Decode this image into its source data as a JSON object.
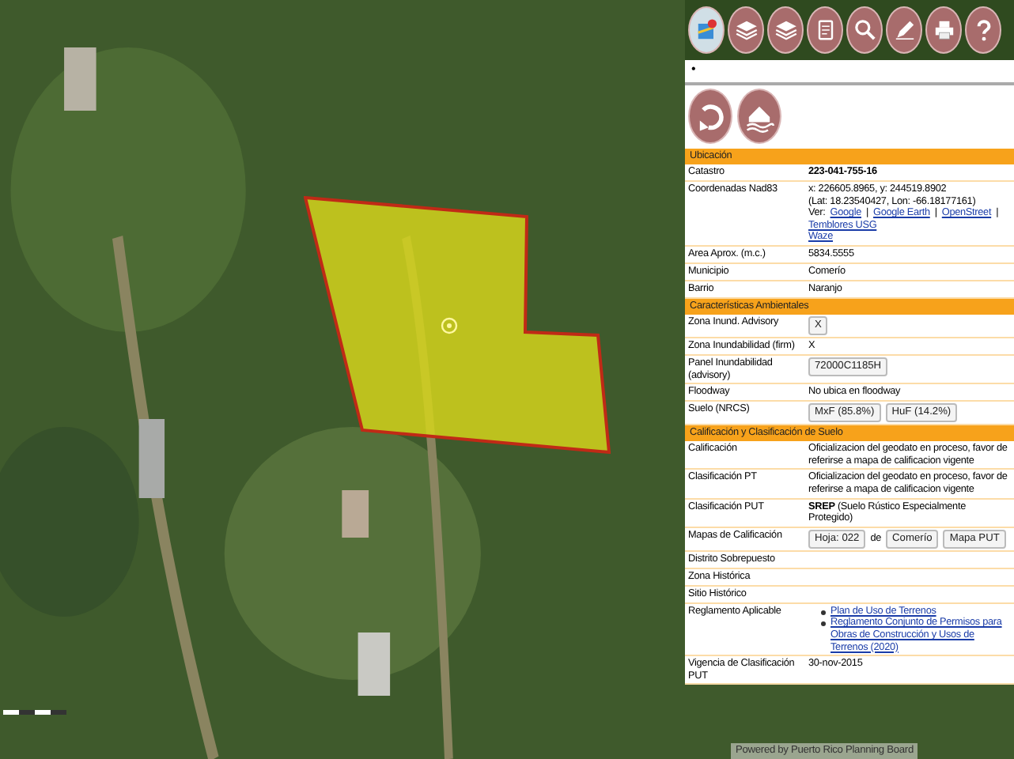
{
  "panel": {
    "marker": "•",
    "sections": [
      {
        "title": "Ubicación",
        "rows": [
          {
            "label": "Catastro",
            "lines": [
              [
                {
                  "kind": "bold",
                  "text": "223-041-755-16"
                }
              ]
            ]
          },
          {
            "label": "Coordenadas Nad83",
            "lines": [
              [
                {
                  "kind": "text",
                  "text": "x: 226605.8965, y: 244519.8902"
                }
              ],
              [
                {
                  "kind": "text",
                  "text": "(Lat: 18.23540427, Lon: -66.18177161)"
                }
              ],
              [
                {
                  "kind": "text",
                  "text": "Ver:"
                },
                {
                  "kind": "link",
                  "text": "Google"
                },
                {
                  "kind": "text",
                  "text": "|"
                },
                {
                  "kind": "link",
                  "text": "Google Earth"
                },
                {
                  "kind": "text",
                  "text": "|"
                },
                {
                  "kind": "link",
                  "text": "OpenStreet"
                },
                {
                  "kind": "text",
                  "text": "|"
                },
                {
                  "kind": "link",
                  "text": "Temblores USG"
                }
              ],
              [
                {
                  "kind": "link",
                  "text": "Waze"
                }
              ]
            ]
          },
          {
            "label": "Area Aprox. (m.c.)",
            "lines": [
              [
                {
                  "kind": "text",
                  "text": "5834.5555"
                }
              ]
            ]
          },
          {
            "label": "Municipio",
            "lines": [
              [
                {
                  "kind": "text",
                  "text": "Comerío"
                }
              ]
            ]
          },
          {
            "label": "Barrio",
            "lines": [
              [
                {
                  "kind": "text",
                  "text": "Naranjo"
                }
              ]
            ]
          }
        ]
      },
      {
        "title": "Características Ambientales",
        "rows": [
          {
            "label": "Zona Inund. Advisory",
            "lines": [
              [
                {
                  "kind": "button",
                  "text": "X"
                }
              ]
            ]
          },
          {
            "label": "Zona Inundabilidad (firm)",
            "lines": [
              [
                {
                  "kind": "text",
                  "text": "X"
                }
              ]
            ]
          },
          {
            "label": "Panel Inundabilidad (advisory)",
            "lines": [
              [
                {
                  "kind": "button",
                  "text": "72000C1185H"
                }
              ]
            ]
          },
          {
            "label": "Floodway",
            "lines": [
              [
                {
                  "kind": "text",
                  "text": "No ubica en floodway"
                }
              ]
            ]
          },
          {
            "label": "Suelo (NRCS)",
            "lines": [
              [
                {
                  "kind": "button",
                  "text": "MxF (85.8%)"
                },
                {
                  "kind": "button",
                  "text": "HuF (14.2%)"
                }
              ]
            ]
          }
        ]
      },
      {
        "title": "Calificación y Clasificación de Suelo",
        "rows": [
          {
            "label": "Calificación",
            "lines": [
              [
                {
                  "kind": "text",
                  "text": "Oficializacion del geodato en proceso, favor de referirse a mapa de calificacion vigente"
                }
              ]
            ]
          },
          {
            "label": "Clasificación PT",
            "lines": [
              [
                {
                  "kind": "text",
                  "text": "Oficializacion del geodato en proceso, favor de referirse a mapa de calificacion vigente"
                }
              ]
            ]
          },
          {
            "label": "Clasificación PUT",
            "lines": [
              [
                {
                  "kind": "rich",
                  "text": "**SREP** (Suelo Rústico Especialmente Protegido)"
                }
              ]
            ]
          },
          {
            "label": "Mapas de Calificación",
            "lines": [
              [
                {
                  "kind": "button",
                  "text": "Hoja: 022"
                },
                {
                  "kind": "text",
                  "text": "de"
                },
                {
                  "kind": "button",
                  "text": "Comerío"
                },
                {
                  "kind": "button",
                  "text": "Mapa PUT"
                }
              ]
            ]
          },
          {
            "label": "Distrito Sobrepuesto",
            "lines": []
          },
          {
            "label": "Zona Histórica",
            "lines": []
          },
          {
            "label": "Sitio Histórico",
            "lines": []
          },
          {
            "label": "Reglamento Aplicable",
            "lines": [
              [
                {
                  "kind": "bullet_link",
                  "text": "Plan de Uso de Terrenos"
                }
              ],
              [
                {
                  "kind": "bullet_link",
                  "text": "Reglamento Conjunto de Permisos para Obras de Construcción y Usos de Terrenos (2020)"
                }
              ]
            ]
          },
          {
            "label": "Vigencia de Clasificación PUT",
            "lines": [
              [
                {
                  "kind": "text",
                  "text": "30-nov-2015"
                }
              ]
            ]
          }
        ]
      }
    ]
  },
  "attribution": "Powered by Puerto Rico Planning Board"
}
